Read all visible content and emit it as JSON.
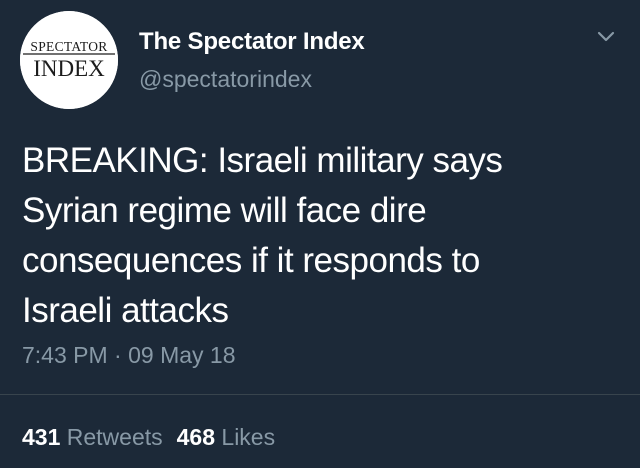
{
  "tweet": {
    "avatar": {
      "logo_top": "SPECTATOR",
      "logo_bottom": "INDEX"
    },
    "display_name": "The Spectator Index",
    "handle": "@spectatorindex",
    "menu_icon": "chevron-down-icon",
    "text_lines": [
      "BREAKING: Israeli military says",
      "Syrian regime will face dire",
      "consequences if it responds to",
      "Israeli attacks"
    ],
    "time": "7:43 PM",
    "separator": "·",
    "date": "09 May 18",
    "retweets": {
      "count": "431",
      "label": "Retweets"
    },
    "likes": {
      "count": "468",
      "label": "Likes"
    }
  },
  "colors": {
    "background": "#1c2938",
    "text": "#ffffff",
    "secondary": "#8899a6",
    "divider": "#38444d"
  }
}
